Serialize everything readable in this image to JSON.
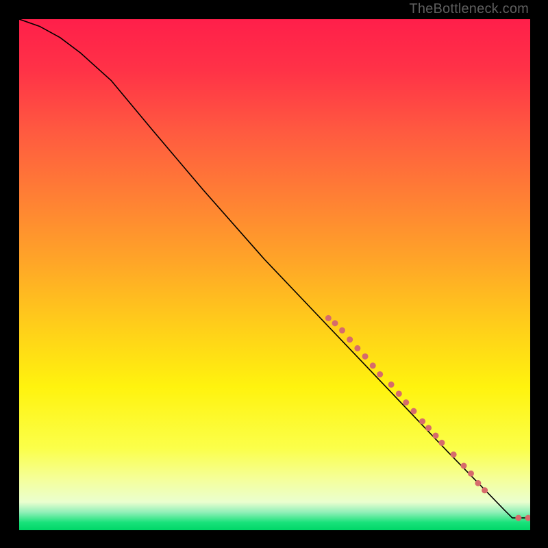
{
  "attribution": "TheBottleneck.com",
  "colors": {
    "bg": "#000000",
    "attribution_text": "#5e5e5e",
    "gradient_stops": [
      {
        "offset": 0.0,
        "color": "#ff1f4a"
      },
      {
        "offset": 0.1,
        "color": "#ff3247"
      },
      {
        "offset": 0.22,
        "color": "#ff5a40"
      },
      {
        "offset": 0.35,
        "color": "#ff8034"
      },
      {
        "offset": 0.48,
        "color": "#ffa727"
      },
      {
        "offset": 0.6,
        "color": "#ffce1a"
      },
      {
        "offset": 0.72,
        "color": "#fff30e"
      },
      {
        "offset": 0.84,
        "color": "#fbff4a"
      },
      {
        "offset": 0.9,
        "color": "#f5ff9a"
      },
      {
        "offset": 0.945,
        "color": "#eaffcf"
      },
      {
        "offset": 0.965,
        "color": "#90f0b8"
      },
      {
        "offset": 0.985,
        "color": "#18e27a"
      },
      {
        "offset": 1.0,
        "color": "#00d768"
      }
    ],
    "curve_stroke": "#000000",
    "marker_fill": "#d66b6b",
    "marker_stroke": "#b24e4e"
  },
  "chart_data": {
    "type": "line",
    "title": "",
    "xlabel": "",
    "ylabel": "",
    "xlim": [
      0,
      100
    ],
    "ylim": [
      0,
      100
    ],
    "curve": [
      {
        "x": 0,
        "y": 100
      },
      {
        "x": 4,
        "y": 98.6
      },
      {
        "x": 8,
        "y": 96.4
      },
      {
        "x": 12,
        "y": 93.4
      },
      {
        "x": 18,
        "y": 88.0
      },
      {
        "x": 26,
        "y": 78.4
      },
      {
        "x": 36,
        "y": 66.6
      },
      {
        "x": 48,
        "y": 53.0
      },
      {
        "x": 60,
        "y": 40.4
      },
      {
        "x": 72,
        "y": 27.8
      },
      {
        "x": 84,
        "y": 15.2
      },
      {
        "x": 92,
        "y": 7.0
      },
      {
        "x": 95,
        "y": 3.9
      },
      {
        "x": 96,
        "y": 2.9
      },
      {
        "x": 96.5,
        "y": 2.4
      },
      {
        "x": 98,
        "y": 2.4
      },
      {
        "x": 100,
        "y": 2.4
      }
    ],
    "markers": [
      {
        "x": 60.5,
        "y": 41.5,
        "r": 4.5
      },
      {
        "x": 61.8,
        "y": 40.5,
        "r": 4.5
      },
      {
        "x": 63.2,
        "y": 39.1,
        "r": 4.5
      },
      {
        "x": 64.7,
        "y": 37.3,
        "r": 4.5
      },
      {
        "x": 66.2,
        "y": 35.6,
        "r": 4.5
      },
      {
        "x": 67.7,
        "y": 34.0,
        "r": 4.5
      },
      {
        "x": 69.2,
        "y": 32.2,
        "r": 4.5
      },
      {
        "x": 70.6,
        "y": 30.5,
        "r": 4.5
      },
      {
        "x": 72.8,
        "y": 28.5,
        "r": 4.5
      },
      {
        "x": 74.3,
        "y": 26.7,
        "r": 4.5
      },
      {
        "x": 75.7,
        "y": 25.0,
        "r": 4.5
      },
      {
        "x": 77.2,
        "y": 23.3,
        "r": 4.5
      },
      {
        "x": 78.9,
        "y": 21.3,
        "r": 4.5
      },
      {
        "x": 80.1,
        "y": 20.0,
        "r": 4.5
      },
      {
        "x": 81.5,
        "y": 18.5,
        "r": 4.5
      },
      {
        "x": 82.7,
        "y": 17.1,
        "r": 4.5
      },
      {
        "x": 85.0,
        "y": 14.8,
        "r": 4.5
      },
      {
        "x": 87.0,
        "y": 12.6,
        "r": 4.5
      },
      {
        "x": 88.4,
        "y": 11.1,
        "r": 4.5
      },
      {
        "x": 89.8,
        "y": 9.2,
        "r": 4.5
      },
      {
        "x": 91.1,
        "y": 7.8,
        "r": 4.5
      },
      {
        "x": 97.7,
        "y": 2.4,
        "r": 4.5
      },
      {
        "x": 99.6,
        "y": 2.4,
        "r": 4.5
      }
    ]
  }
}
